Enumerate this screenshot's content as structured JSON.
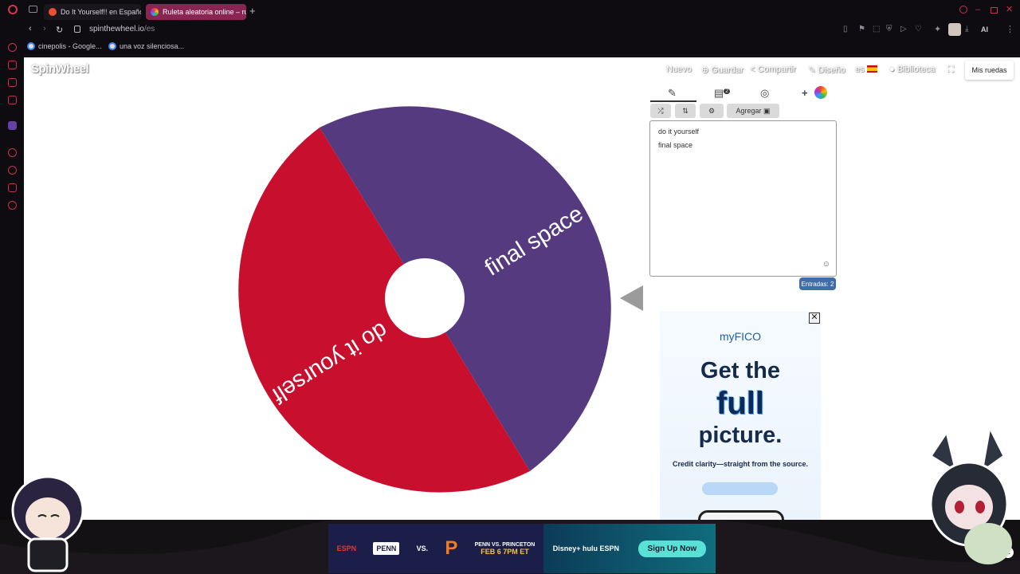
{
  "browser": {
    "tabs": [
      {
        "title": "Do It Yourself!! en Españo",
        "active": false
      },
      {
        "title": "Ruleta aleatoria online – ru",
        "active": true
      }
    ],
    "url_host": "spinthewheel.io",
    "url_path": "/es",
    "bookmarks": [
      "cinepolis - Google...",
      "una voz silenciosa..."
    ],
    "toolbar_ai": "AI",
    "sidebar_badge": "GX"
  },
  "site": {
    "logo": "SpinWheel",
    "nav": [
      "Nuevo",
      "Guardar",
      "Compartir",
      "Diseño",
      "es",
      "Biblioteca"
    ],
    "my_wheels": "Mis ruedas"
  },
  "wheel": {
    "segments": [
      {
        "label": "final space",
        "color": "#553a80"
      },
      {
        "label": "do it yourself",
        "color": "#c8102e"
      }
    ],
    "hub_color": "#ffffff"
  },
  "editor": {
    "hidden_badge": "2",
    "add_label": "Agregar",
    "entries": [
      "do it yourself",
      "final space"
    ],
    "entry_count_label": "Entradas: 2"
  },
  "ads": {
    "side": {
      "brand": "myFICO",
      "headline_1": "Get the",
      "headline_2": "full",
      "headline_3": "picture.",
      "subtext": "Credit clarity—straight from the source."
    },
    "bottom": {
      "team_1": "PENN",
      "vs": "VS.",
      "matchup": "PENN VS. PRINCETON",
      "date": "FEB 6 7PM ET",
      "brands": "Disney+ hulu ESPN",
      "cta": "Sign Up Now"
    }
  }
}
